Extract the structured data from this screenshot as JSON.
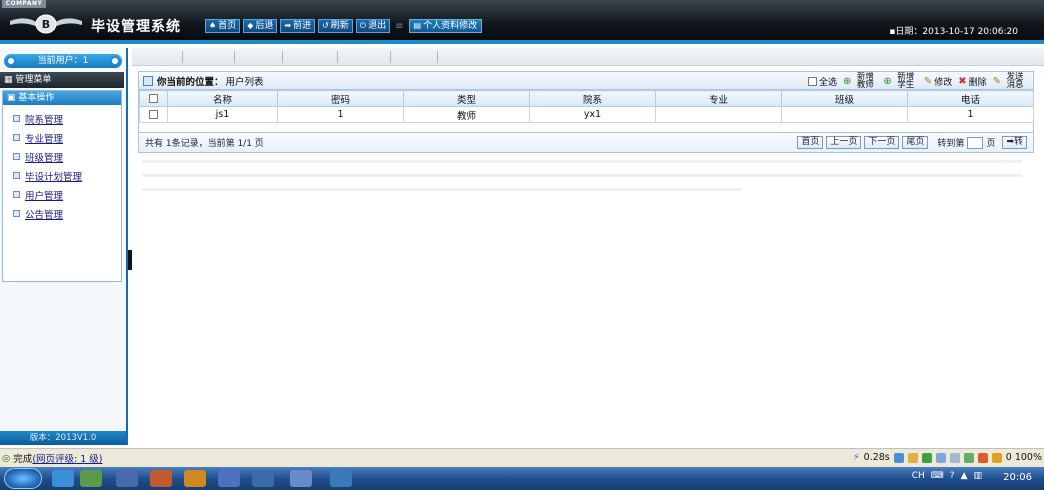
{
  "header": {
    "company": "COMPANY",
    "title": "毕设管理系统",
    "nav": [
      {
        "label": "首页",
        "icon": "home-icon",
        "glyph": "♠"
      },
      {
        "label": "后退",
        "icon": "back-icon",
        "glyph": "◆"
      },
      {
        "label": "前进",
        "icon": "forward-icon",
        "glyph": "➡"
      },
      {
        "label": "刷新",
        "icon": "refresh-icon",
        "glyph": "↺"
      },
      {
        "label": "退出",
        "icon": "power-icon",
        "glyph": "⏻"
      }
    ],
    "profile_button": "个人资料修改",
    "date_label": "日期：",
    "date_value": "2013-10-17 20:06:20"
  },
  "sidebar": {
    "current_user": "当前用户：1",
    "menu_title": "管理菜单",
    "section_title": "基本操作",
    "items": [
      "院系管理",
      "专业管理",
      "班级管理",
      "毕设计划管理",
      "用户管理",
      "公告管理"
    ],
    "version": "版本：2013V1.0"
  },
  "main": {
    "location_label": "你当前的位置：",
    "location_value": "用户列表",
    "actions": {
      "select_all": "全选",
      "add_teacher": "新增教师",
      "add_student": "新增学生",
      "edit": "修改",
      "delete": "删除",
      "send_msg": "发送消息"
    },
    "table": {
      "headers": [
        "名称",
        "密码",
        "类型",
        "院系",
        "专业",
        "班级",
        "电话"
      ],
      "rows": [
        [
          "js1",
          "1",
          "教师",
          "yx1",
          "",
          "",
          "1"
        ]
      ]
    },
    "pager": {
      "summary": "共有 1条记录，当前第 1/1 页",
      "first": "首页",
      "prev": "上一页",
      "next": "下一页",
      "last": "尾页",
      "goto_label": "转到第",
      "page_unit": "页",
      "go": "➡转"
    }
  },
  "statusbar": {
    "status": "完成",
    "link": "(网页评级: 1 级)",
    "time": "0.28s",
    "zoom": "0 100%"
  },
  "taskbar": {
    "lang": "CH",
    "clock": "20:06"
  }
}
